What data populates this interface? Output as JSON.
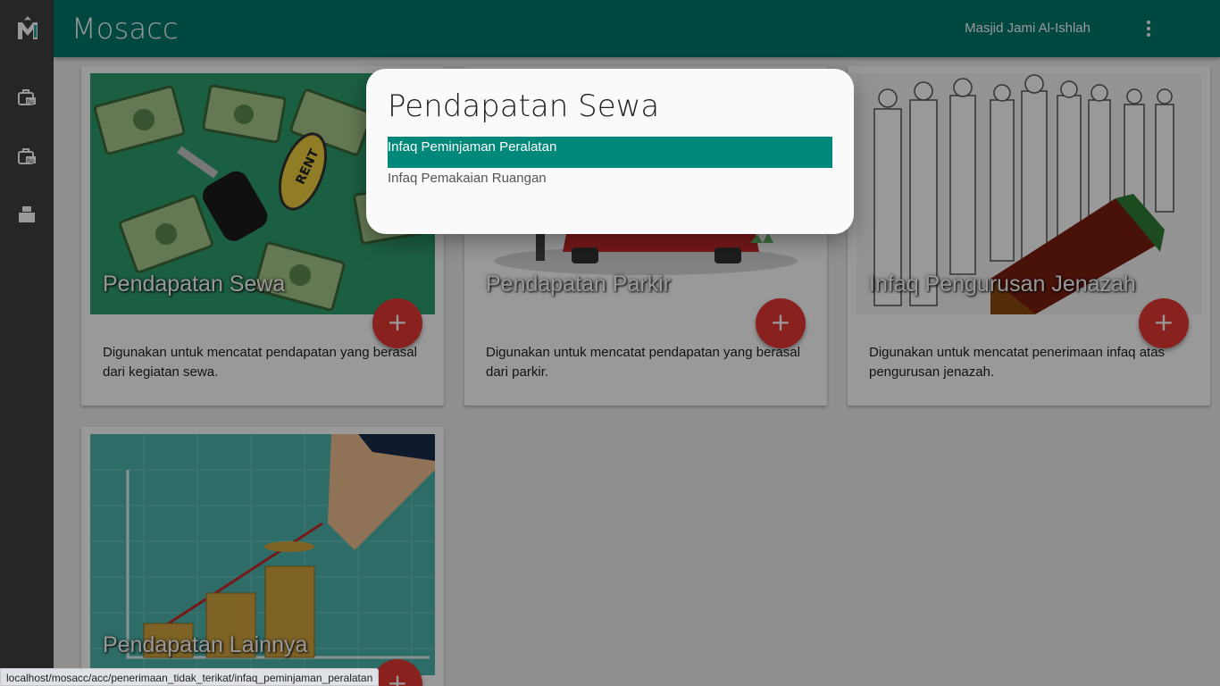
{
  "app": {
    "brand": "Mosacc",
    "organization": "Masjid Jami Al-Ishlah",
    "accent": "#00796b",
    "logo_icon": "mosacc-logo-icon"
  },
  "sidebar": {
    "items": [
      {
        "name": "receipt-rp-icon"
      },
      {
        "name": "receipt-rp-alt-icon"
      },
      {
        "name": "printer-icon"
      }
    ]
  },
  "cards": [
    {
      "title": "Pendapatan Sewa",
      "description": "Digunakan untuk mencatat pendapatan yang berasal dari kegiatan sewa.",
      "add": "+"
    },
    {
      "title": "Pendapatan Parkir",
      "description": "Digunakan untuk mencatat pendapatan yang berasal dari parkir.",
      "add": "+"
    },
    {
      "title": "Infaq Pengurusan Jenazah",
      "description": "Digunakan untuk mencatat penerimaan infaq atas pengurusan jenazah.",
      "add": "+"
    },
    {
      "title": "Pendapatan Lainnya",
      "description": "",
      "add": "+"
    }
  ],
  "dialog": {
    "title": "Pendapatan Sewa",
    "options": [
      {
        "label": "Infaq Peminjaman Peralatan",
        "selected": true
      },
      {
        "label": "Infaq Pemakaian Ruangan",
        "selected": false
      }
    ]
  },
  "status_bar": {
    "url": "localhost/mosacc/acc/penerimaan_tidak_terikat/infaq_peminjaman_peralatan"
  }
}
